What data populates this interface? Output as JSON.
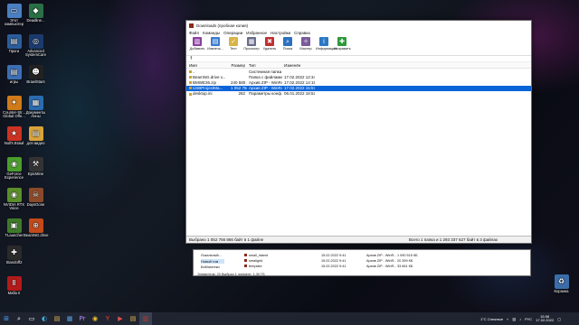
{
  "desktop_icons": [
    {
      "id": "computer",
      "label": "Этот компьютер",
      "color": "#4a7fc1",
      "glyph": "▭"
    },
    {
      "id": "deadline",
      "label": "Deadline...",
      "color": "#2a6f46",
      "glyph": "◆"
    },
    {
      "id": "trash-left",
      "label": "Проги",
      "color": "#2b5d9c",
      "glyph": "▤"
    },
    {
      "id": "advanced-systemcare",
      "label": "Advanced SystemCare",
      "color": "#1b3a6e",
      "glyph": "◎"
    },
    {
      "id": "games",
      "label": "игры",
      "color": "#3d6fb5",
      "glyph": "▤"
    },
    {
      "id": "brawlstars",
      "label": "BrawlStars",
      "color": "#222222",
      "glyph": "☻"
    },
    {
      "id": "counter-strike",
      "label": "Counter-Str... Global Offe...",
      "color": "#d07a1a",
      "glyph": "✦"
    },
    {
      "id": "docs",
      "label": "Документы Анны",
      "color": "#2b6cb0",
      "glyph": "▦"
    },
    {
      "id": "nulls-brawl",
      "label": "Null's Brawl",
      "color": "#cc3322",
      "glyph": "★"
    },
    {
      "id": "video",
      "label": "для видео",
      "color": "#d9a43a",
      "glyph": "▤"
    },
    {
      "id": "geforce",
      "label": "GeForce Experience",
      "color": "#4a9e2b",
      "glyph": "◉"
    },
    {
      "id": "epicmine",
      "label": "EpicMine",
      "color": "#333333",
      "glyph": "⚒"
    },
    {
      "id": "nvidia-rtx",
      "label": "NVIDIA RTX Voice",
      "color": "#5b8e2b",
      "glyph": "◉"
    },
    {
      "id": "daysgone",
      "label": "DaysGone",
      "color": "#8a4a2a",
      "glyph": "☠"
    },
    {
      "id": "tlauncher",
      "label": "TLauncher",
      "color": "#3f7a2a",
      "glyph": "▣"
    },
    {
      "id": "beamng",
      "label": "BeamNG.drive",
      "color": "#c24a1a",
      "glyph": "⊕"
    },
    {
      "id": "standoff",
      "label": "Standoff2",
      "color": "#2a2a2a",
      "glyph": "✚"
    },
    {
      "id": "mafia",
      "label": "Mafia II",
      "color": "#b31a1a",
      "glyph": "Ⅱ"
    },
    {
      "id": "recycle-bin",
      "label": "Корзина",
      "color": "#3b6ea8",
      "glyph": "♻"
    }
  ],
  "window": {
    "title": "Downloads (пробная копия)",
    "menu": [
      "Файл",
      "Команды",
      "Операции",
      "Избранное",
      "Настройки",
      "Справка"
    ],
    "toolbar": [
      {
        "label": "Добавить",
        "color": "#8a3fa0",
        "icon": "books-icon",
        "glyph": "▥"
      },
      {
        "label": "Извлечь...",
        "color": "#3b7bd0",
        "icon": "folder-icon",
        "glyph": "▤"
      },
      {
        "label": "Тест",
        "color": "#d9b347",
        "icon": "test-icon",
        "glyph": "✓"
      },
      {
        "label": "Просмотр",
        "color": "#6a6a8a",
        "icon": "view-icon",
        "glyph": "▦"
      },
      {
        "label": "Удалить",
        "color": "#c03030",
        "icon": "delete-icon",
        "glyph": "✖"
      },
      {
        "label": "Поиск",
        "color": "#2d6fbf",
        "icon": "search-icon",
        "glyph": "⌕"
      },
      {
        "label": "Мастер",
        "color": "#7a5a9a",
        "icon": "wizard-icon",
        "glyph": "✧"
      },
      {
        "label": "Информация",
        "color": "#2c78c4",
        "icon": "info-icon",
        "glyph": "i"
      },
      {
        "label": "Исправить",
        "color": "#2f9a3b",
        "icon": "repair-icon",
        "glyph": "✚"
      }
    ],
    "path_arrow": "↑",
    "columns": {
      "name": "Имя",
      "size": "Размер",
      "type": "Тип",
      "date": "Изменён"
    },
    "rows": [
      {
        "name": "..",
        "size": "",
        "type": "Системная папка",
        "date": "",
        "selected": false
      },
      {
        "name": "BeamNG.drive v...",
        "size": "",
        "type": "Папка с файлами",
        "date": "17.02.2022 12:34",
        "selected": false
      },
      {
        "name": "BMWE36.zip",
        "size": "240 580 479",
        "type": "Архив ZIP - WinRAR",
        "date": "17.02.2022 14:15",
        "selected": false
      },
      {
        "name": "USBProjectMa...",
        "size": "1 052 756 8...",
        "type": "Архив ZIP - WinRAR",
        "date": "17.02.2022 15:57",
        "selected": true
      },
      {
        "name": "desktop.ini",
        "size": "282",
        "type": "Параметры конф...",
        "date": "06.01.2022 18:52",
        "selected": false
      }
    ],
    "status_left": "Выбрано 1 052 756 866 байт в 1 файле",
    "status_right": "Всего 1 папка и 1 293 337 627 байт в 3 файлах"
  },
  "background_window": {
    "nav": [
      "Локальный...",
      "Новый том",
      "Библиотеки"
    ],
    "files": [
      {
        "name": "small_island",
        "date": "15.02.2022 9:41",
        "type": "Архив ZIP - WinR...",
        "size": "1 090 515 КБ"
      },
      {
        "name": "smallgrid",
        "date": "15.02.2022 9:41",
        "type": "Архив ZIP - WinR...",
        "size": "20 399 КБ"
      },
      {
        "name": "template",
        "date": "15.02.2022 9:41",
        "type": "Архив ZIP - WinR...",
        "size": "33 661 КБ"
      }
    ],
    "status": "Элементов: 20    Выбран 1 элемент: 1,30 ГБ"
  },
  "taskbar": {
    "weather": "1°C Снежные",
    "lang": "РУС",
    "time": "15:58",
    "date": "17.02.2022"
  }
}
